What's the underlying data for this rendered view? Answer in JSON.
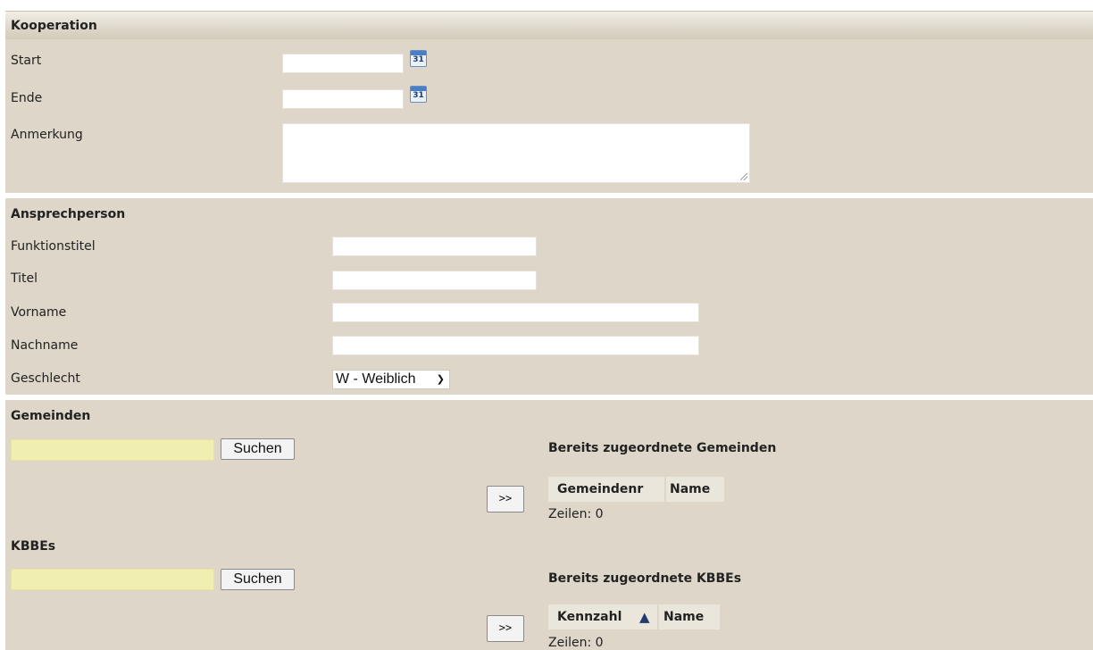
{
  "kooperation": {
    "title": "Kooperation",
    "start_label": "Start",
    "ende_label": "Ende",
    "anmerkung_label": "Anmerkung",
    "calendar_icon_text": "31"
  },
  "ansprechperson": {
    "title": "Ansprechperson",
    "funktionstitel_label": "Funktionstitel",
    "titel_label": "Titel",
    "vorname_label": "Vorname",
    "nachname_label": "Nachname",
    "geschlecht_label": "Geschlecht",
    "geschlecht_value": "W - Weiblich"
  },
  "gemeinden": {
    "title": "Gemeinden",
    "search_button": "Suchen",
    "add_button": ">>",
    "assigned_title": "Bereits zugeordnete Gemeinden",
    "columns": [
      "Gemeindenr",
      "Name"
    ],
    "rows_label": "Zeilen: 0"
  },
  "kbbes": {
    "title": "KBBEs",
    "search_button": "Suchen",
    "add_button": ">>",
    "assigned_title": "Bereits zugeordnete KBBEs",
    "columns": [
      "Kennzahl",
      "Name"
    ],
    "sort_icon": "▲",
    "rows_label": "Zeilen: 0"
  },
  "colors": {
    "panel_bg": "#ddd6c9",
    "search_input_bg": "#f0efb0",
    "sort_icon": "#1f3c6b"
  }
}
